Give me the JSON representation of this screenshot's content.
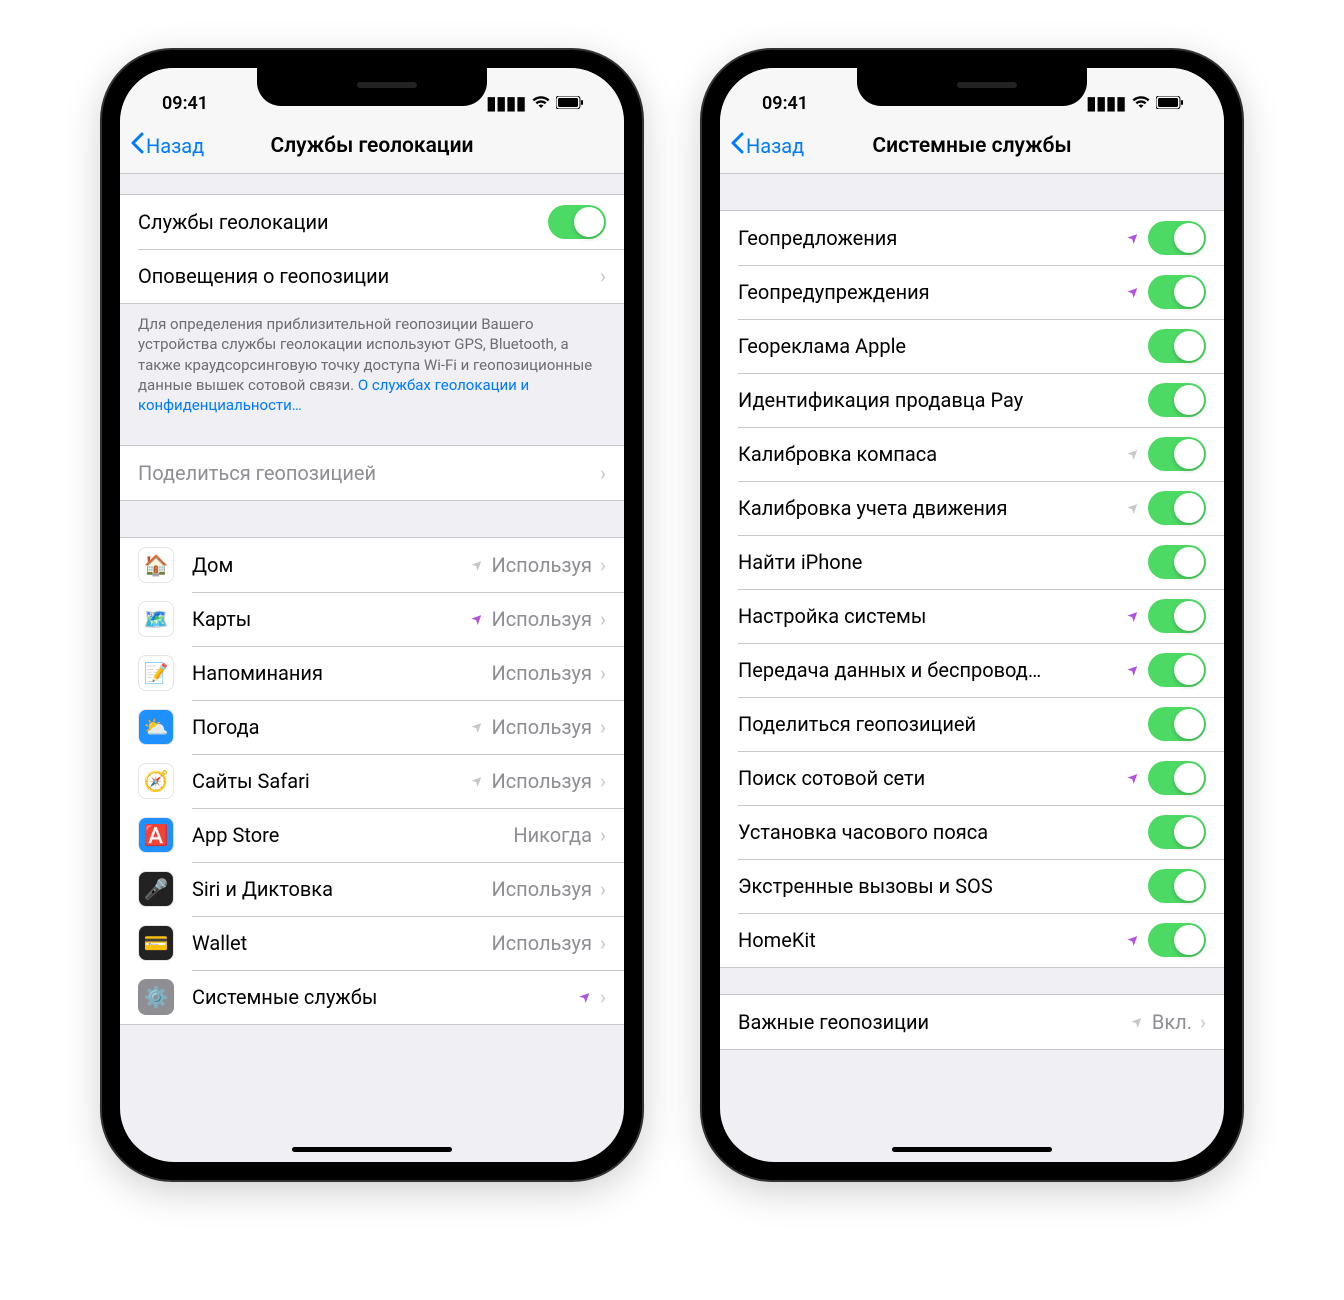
{
  "statusBar": {
    "time": "09:41"
  },
  "left": {
    "back": "Назад",
    "title": "Службы геолокации",
    "topRows": [
      {
        "label": "Службы геолокации",
        "type": "toggle",
        "on": true
      },
      {
        "label": "Оповещения о геопозиции",
        "type": "chevron"
      }
    ],
    "footer": "Для определения приблизительной геопозиции Вашего устройства службы геолокации используют GPS, Bluetooth, а также краудсорсинговую точку доступа Wi-Fi и геопозиционные данные вышек сотовой связи. ",
    "footerLink": "О службах геолокации и конфиденциальности…",
    "shareRow": {
      "label": "Поделиться геопозицией"
    },
    "apps": [
      {
        "name": "Дом",
        "status": "Используя",
        "loc": "gray",
        "iconBg": "#fff",
        "iconEmoji": "🏠"
      },
      {
        "name": "Карты",
        "status": "Используя",
        "loc": "purple",
        "iconBg": "#fff",
        "iconEmoji": "🗺️"
      },
      {
        "name": "Напоминания",
        "status": "Используя",
        "loc": "none",
        "iconBg": "#fff",
        "iconEmoji": "📝"
      },
      {
        "name": "Погода",
        "status": "Используя",
        "loc": "gray",
        "iconBg": "#1e90ff",
        "iconEmoji": "⛅"
      },
      {
        "name": "Сайты Safari",
        "status": "Используя",
        "loc": "gray",
        "iconBg": "#fff",
        "iconEmoji": "🧭"
      },
      {
        "name": "App Store",
        "status": "Никогда",
        "loc": "none",
        "iconBg": "#1e90ff",
        "iconEmoji": "🅰️"
      },
      {
        "name": "Siri и Диктовка",
        "status": "Используя",
        "loc": "none",
        "iconBg": "#222",
        "iconEmoji": "🎤"
      },
      {
        "name": "Wallet",
        "status": "Используя",
        "loc": "none",
        "iconBg": "#222",
        "iconEmoji": "💳"
      },
      {
        "name": "Системные службы",
        "status": "",
        "loc": "purple",
        "iconBg": "#8e8e93",
        "iconEmoji": "⚙️"
      }
    ]
  },
  "right": {
    "back": "Назад",
    "title": "Системные службы",
    "rows": [
      {
        "label": "Геопредложения",
        "loc": "purple"
      },
      {
        "label": "Геопредупреждения",
        "loc": "purple"
      },
      {
        "label": "Геореклама Apple",
        "loc": "none"
      },
      {
        "label": "Идентификация продавца Pay",
        "loc": "none"
      },
      {
        "label": "Калибровка компаса",
        "loc": "gray"
      },
      {
        "label": "Калибровка учета движения",
        "loc": "gray"
      },
      {
        "label": "Найти iPhone",
        "loc": "none"
      },
      {
        "label": "Настройка системы",
        "loc": "purple"
      },
      {
        "label": "Передача данных и беспровод…",
        "loc": "purple"
      },
      {
        "label": "Поделиться геопозицией",
        "loc": "none"
      },
      {
        "label": "Поиск сотовой сети",
        "loc": "purple"
      },
      {
        "label": "Установка часового пояса",
        "loc": "none"
      },
      {
        "label": "Экстренные вызовы и SOS",
        "loc": "none"
      },
      {
        "label": "HomeKit",
        "loc": "purple"
      }
    ],
    "lastRow": {
      "label": "Важные геопозиции",
      "value": "Вкл.",
      "loc": "gray"
    }
  }
}
